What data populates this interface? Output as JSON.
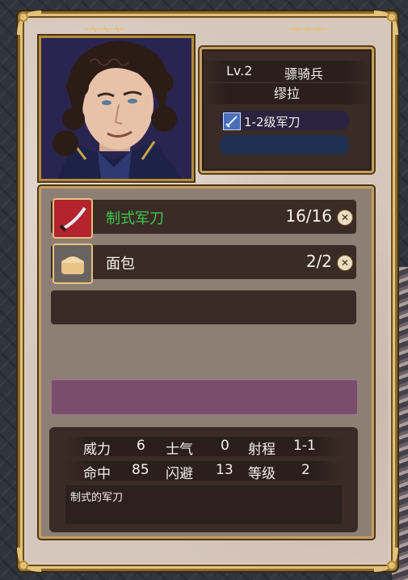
{
  "unit": {
    "level": "Lv.2",
    "class": "骠骑兵",
    "name": "缪拉",
    "weapon": "1-2级军刀"
  },
  "items": [
    {
      "name": "制式军刀",
      "count": "16/16",
      "name_color": "#3cc84a",
      "icon": "saber-icon"
    },
    {
      "name": "面包",
      "count": "2/2",
      "name_color": "#f5f0ea",
      "icon": "bread-icon"
    }
  ],
  "stats": {
    "row1": [
      {
        "label": "威力",
        "value": "6"
      },
      {
        "label": "士气",
        "value": "0"
      },
      {
        "label": "射程",
        "value": "1-1"
      }
    ],
    "row2": [
      {
        "label": "命中",
        "value": "85"
      },
      {
        "label": "闪避",
        "value": "13"
      },
      {
        "label": "等级",
        "value": "2"
      }
    ],
    "description": "制式的军刀"
  },
  "colors": {
    "frame_gold": "#c4a060",
    "panel_dark": "#3a2b26",
    "highlight_purple": "#7a4d6c"
  }
}
